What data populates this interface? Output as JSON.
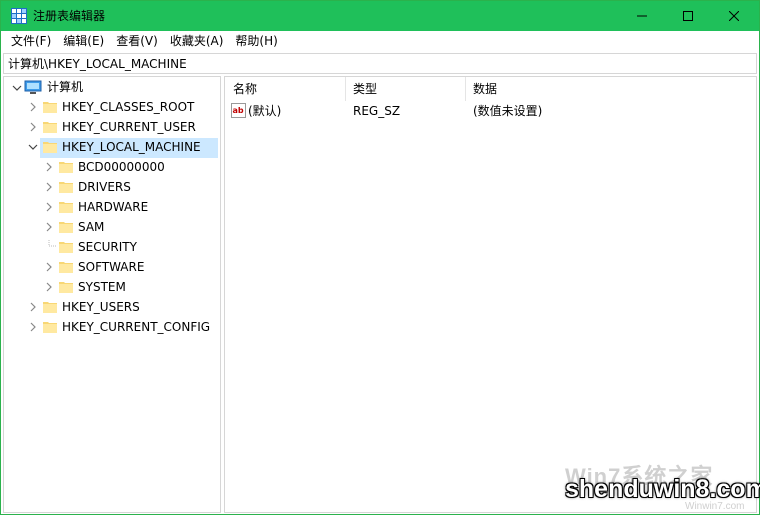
{
  "window": {
    "title": "注册表编辑器",
    "accent_color": "#1fc05a"
  },
  "menu": [
    "文件(F)",
    "编辑(E)",
    "查看(V)",
    "收藏夹(A)",
    "帮助(H)"
  ],
  "address": "计算机\\HKEY_LOCAL_MACHINE",
  "tree": {
    "root": "计算机",
    "hives": {
      "classes_root": "HKEY_CLASSES_ROOT",
      "current_user": "HKEY_CURRENT_USER",
      "local_machine": "HKEY_LOCAL_MACHINE",
      "users": "HKEY_USERS",
      "current_config": "HKEY_CURRENT_CONFIG"
    },
    "local_machine_children": [
      "BCD00000000",
      "DRIVERS",
      "HARDWARE",
      "SAM",
      "SECURITY",
      "SOFTWARE",
      "SYSTEM"
    ]
  },
  "list": {
    "columns": [
      "名称",
      "类型",
      "数据"
    ],
    "rows": [
      {
        "name": "(默认)",
        "type": "REG_SZ",
        "data": "(数值未设置)",
        "icon": "string-value-icon"
      }
    ]
  },
  "watermark": {
    "logo": "Win7系统之家",
    "text": "shenduwin8.com",
    "sub": "Winwin7.com"
  }
}
